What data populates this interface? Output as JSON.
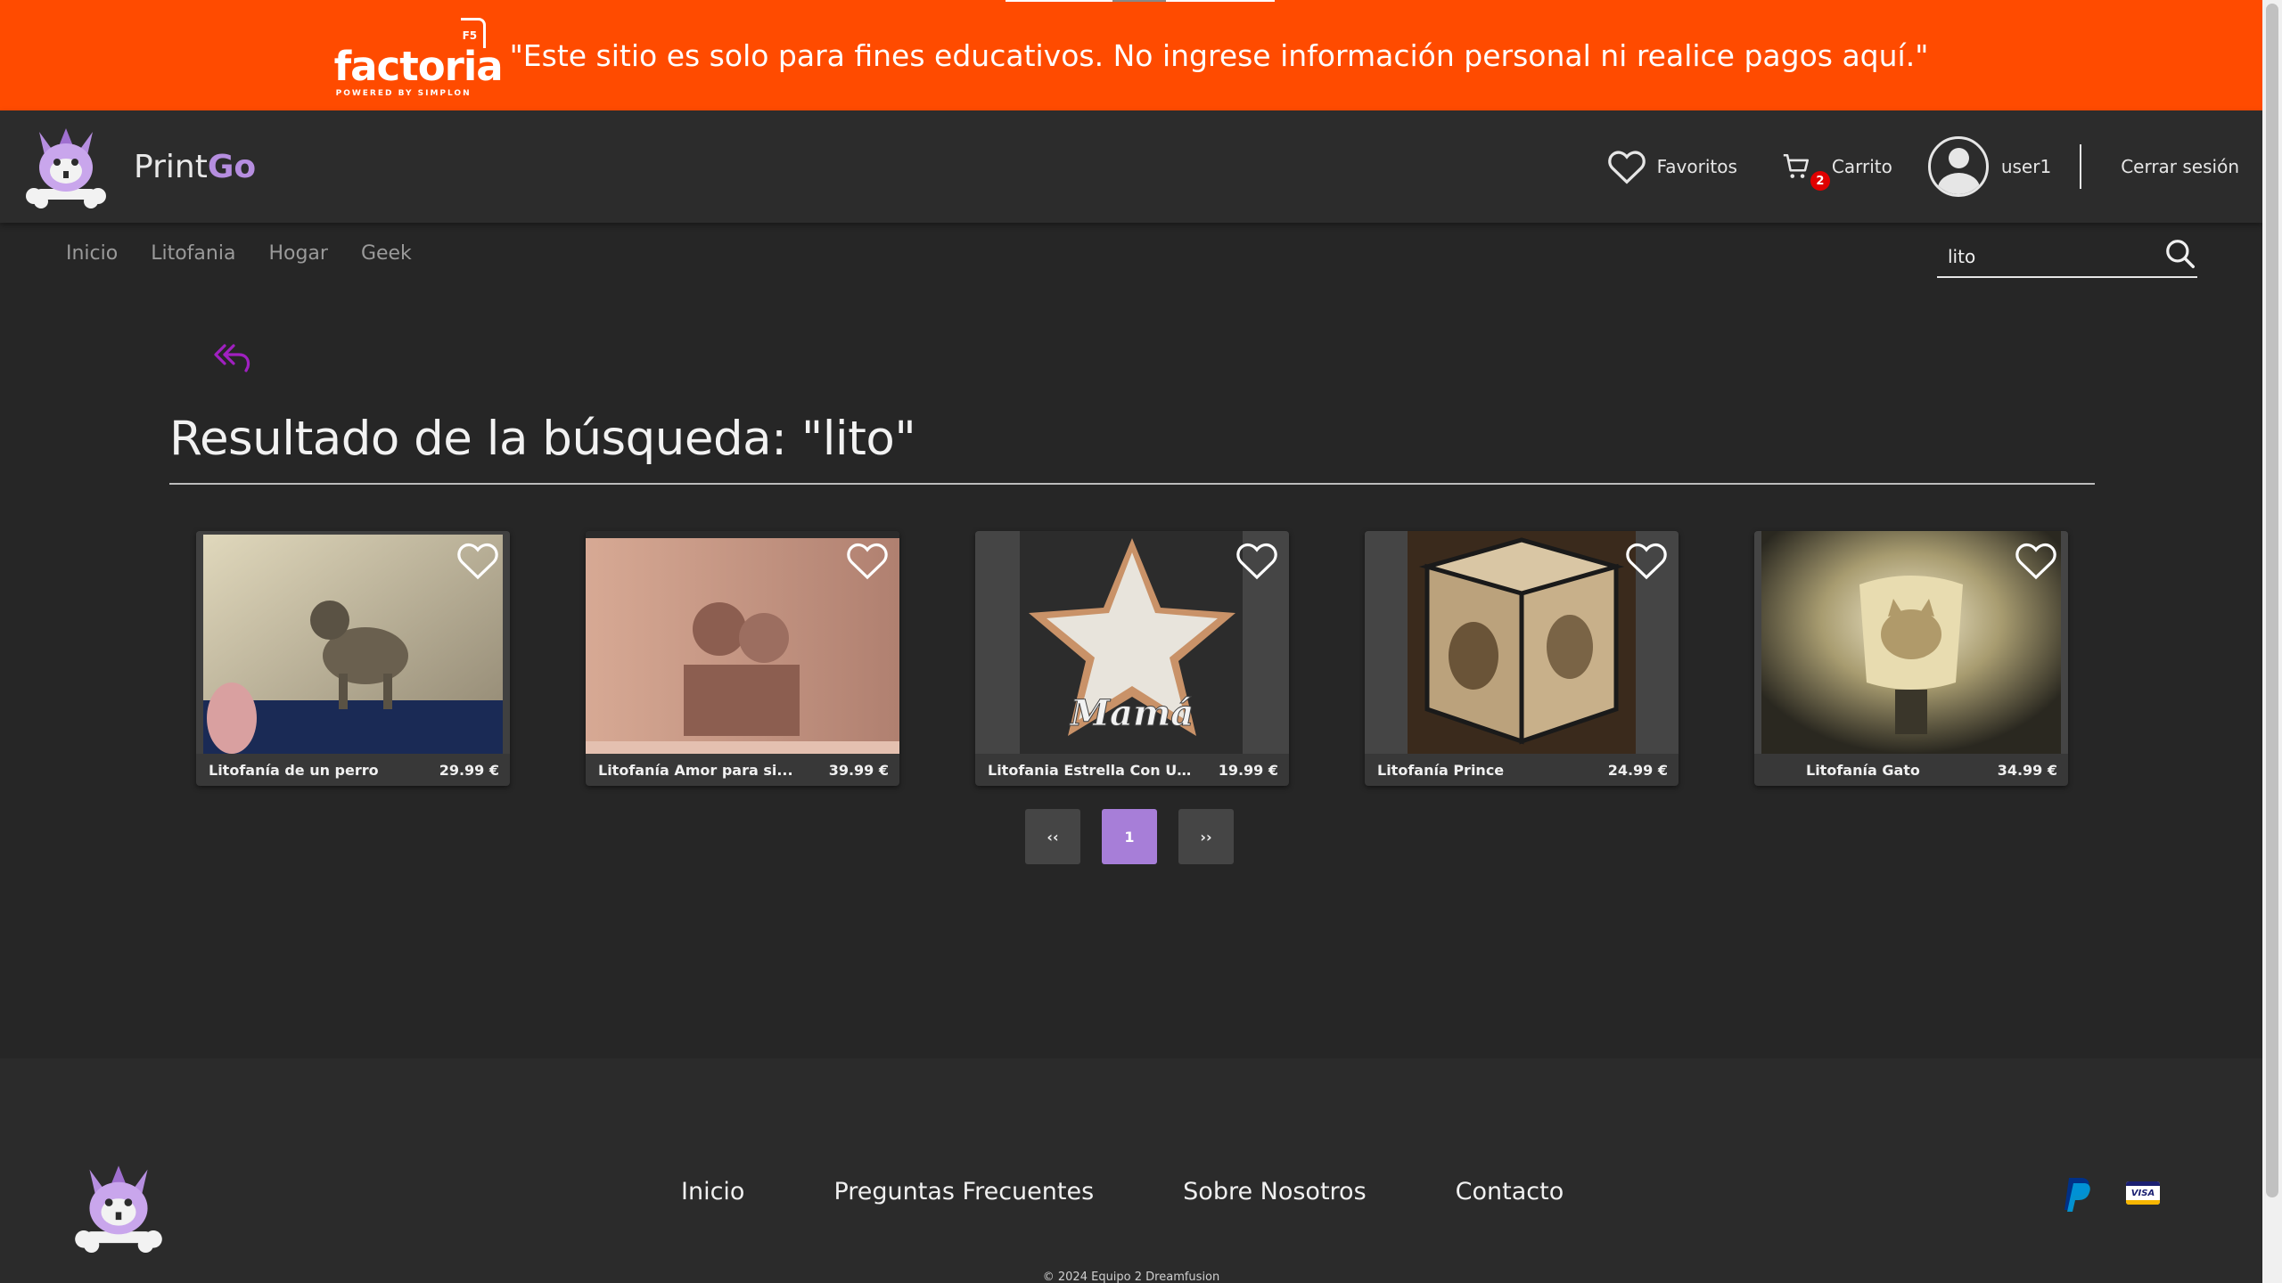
{
  "banner": {
    "logo_text": "factoria",
    "logo_badge": "F5",
    "logo_powered": "POWERED BY SIMPLON",
    "message": "\"Este sitio es solo para fines educativos. No ingrese información personal ni realice pagos aquí.\"",
    "color": "#ff4b00"
  },
  "header": {
    "brand_part1": "Print",
    "brand_part2": "Go",
    "favorites_label": "Favoritos",
    "cart_label": "Carrito",
    "cart_count": "2",
    "username": "user1",
    "logout_label": "Cerrar sesión",
    "accent": "#b68ee0"
  },
  "nav": {
    "items": [
      "Inicio",
      "Litofania",
      "Hogar",
      "Geek"
    ]
  },
  "search": {
    "value": "lito"
  },
  "results": {
    "title": "Resultado de la búsqueda: \"lito\"",
    "products": [
      {
        "name": "Litofanía de un perro",
        "price": "29.99 €"
      },
      {
        "name": "Litofanía Amor para si...",
        "price": "39.99 €"
      },
      {
        "name": "Litofania Estrella Con U...",
        "price": "19.99 €"
      },
      {
        "name": "Litofanía Prince",
        "price": "24.99 €"
      },
      {
        "name": "Litofanía Gato",
        "price": "34.99 €"
      }
    ]
  },
  "pagination": {
    "prev": "‹‹",
    "current": "1",
    "next": "››",
    "active_color": "#a77ed8"
  },
  "footer": {
    "links": [
      "Inicio",
      "Preguntas Frecuentes",
      "Sobre Nosotros",
      "Contacto"
    ],
    "visa_label": "VISA",
    "copyright": "© 2024 Equipo 2 Dreamfusion"
  }
}
